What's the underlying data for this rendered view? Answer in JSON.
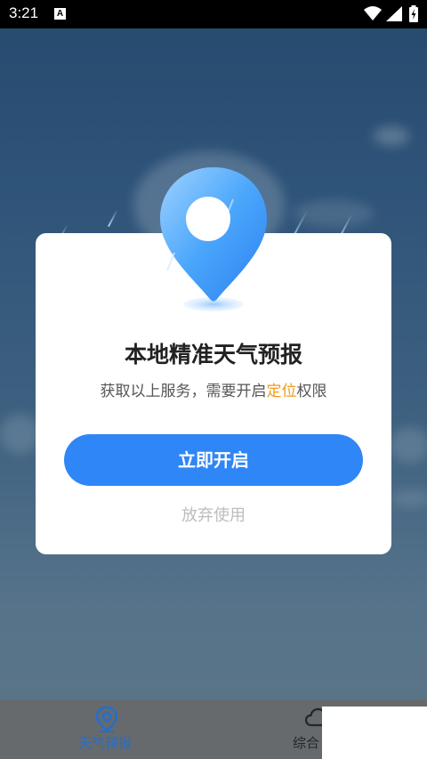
{
  "status_bar": {
    "time": "3:21",
    "notification_icon": "A",
    "icons": [
      "wifi-icon",
      "signal-icon",
      "battery-charging-icon"
    ]
  },
  "dialog": {
    "icon": "location-pin-icon",
    "title": "本地精准天气预报",
    "subtitle_before": "获取以上服务，需要开启",
    "subtitle_highlight": "定位",
    "subtitle_after": "权限",
    "primary_button": "立即开启",
    "secondary_link": "放弃使用"
  },
  "bottom_nav": {
    "tabs": [
      {
        "label": "天气预报",
        "icon": "location-pin-icon",
        "active": true
      },
      {
        "label": "综合",
        "icon": "cloud-icon",
        "active": false
      }
    ]
  },
  "colors": {
    "accent": "#2f86f6",
    "highlight": "#f09a1a",
    "active_tab": "#1e6fd4",
    "nav_background": "#666a6d"
  }
}
